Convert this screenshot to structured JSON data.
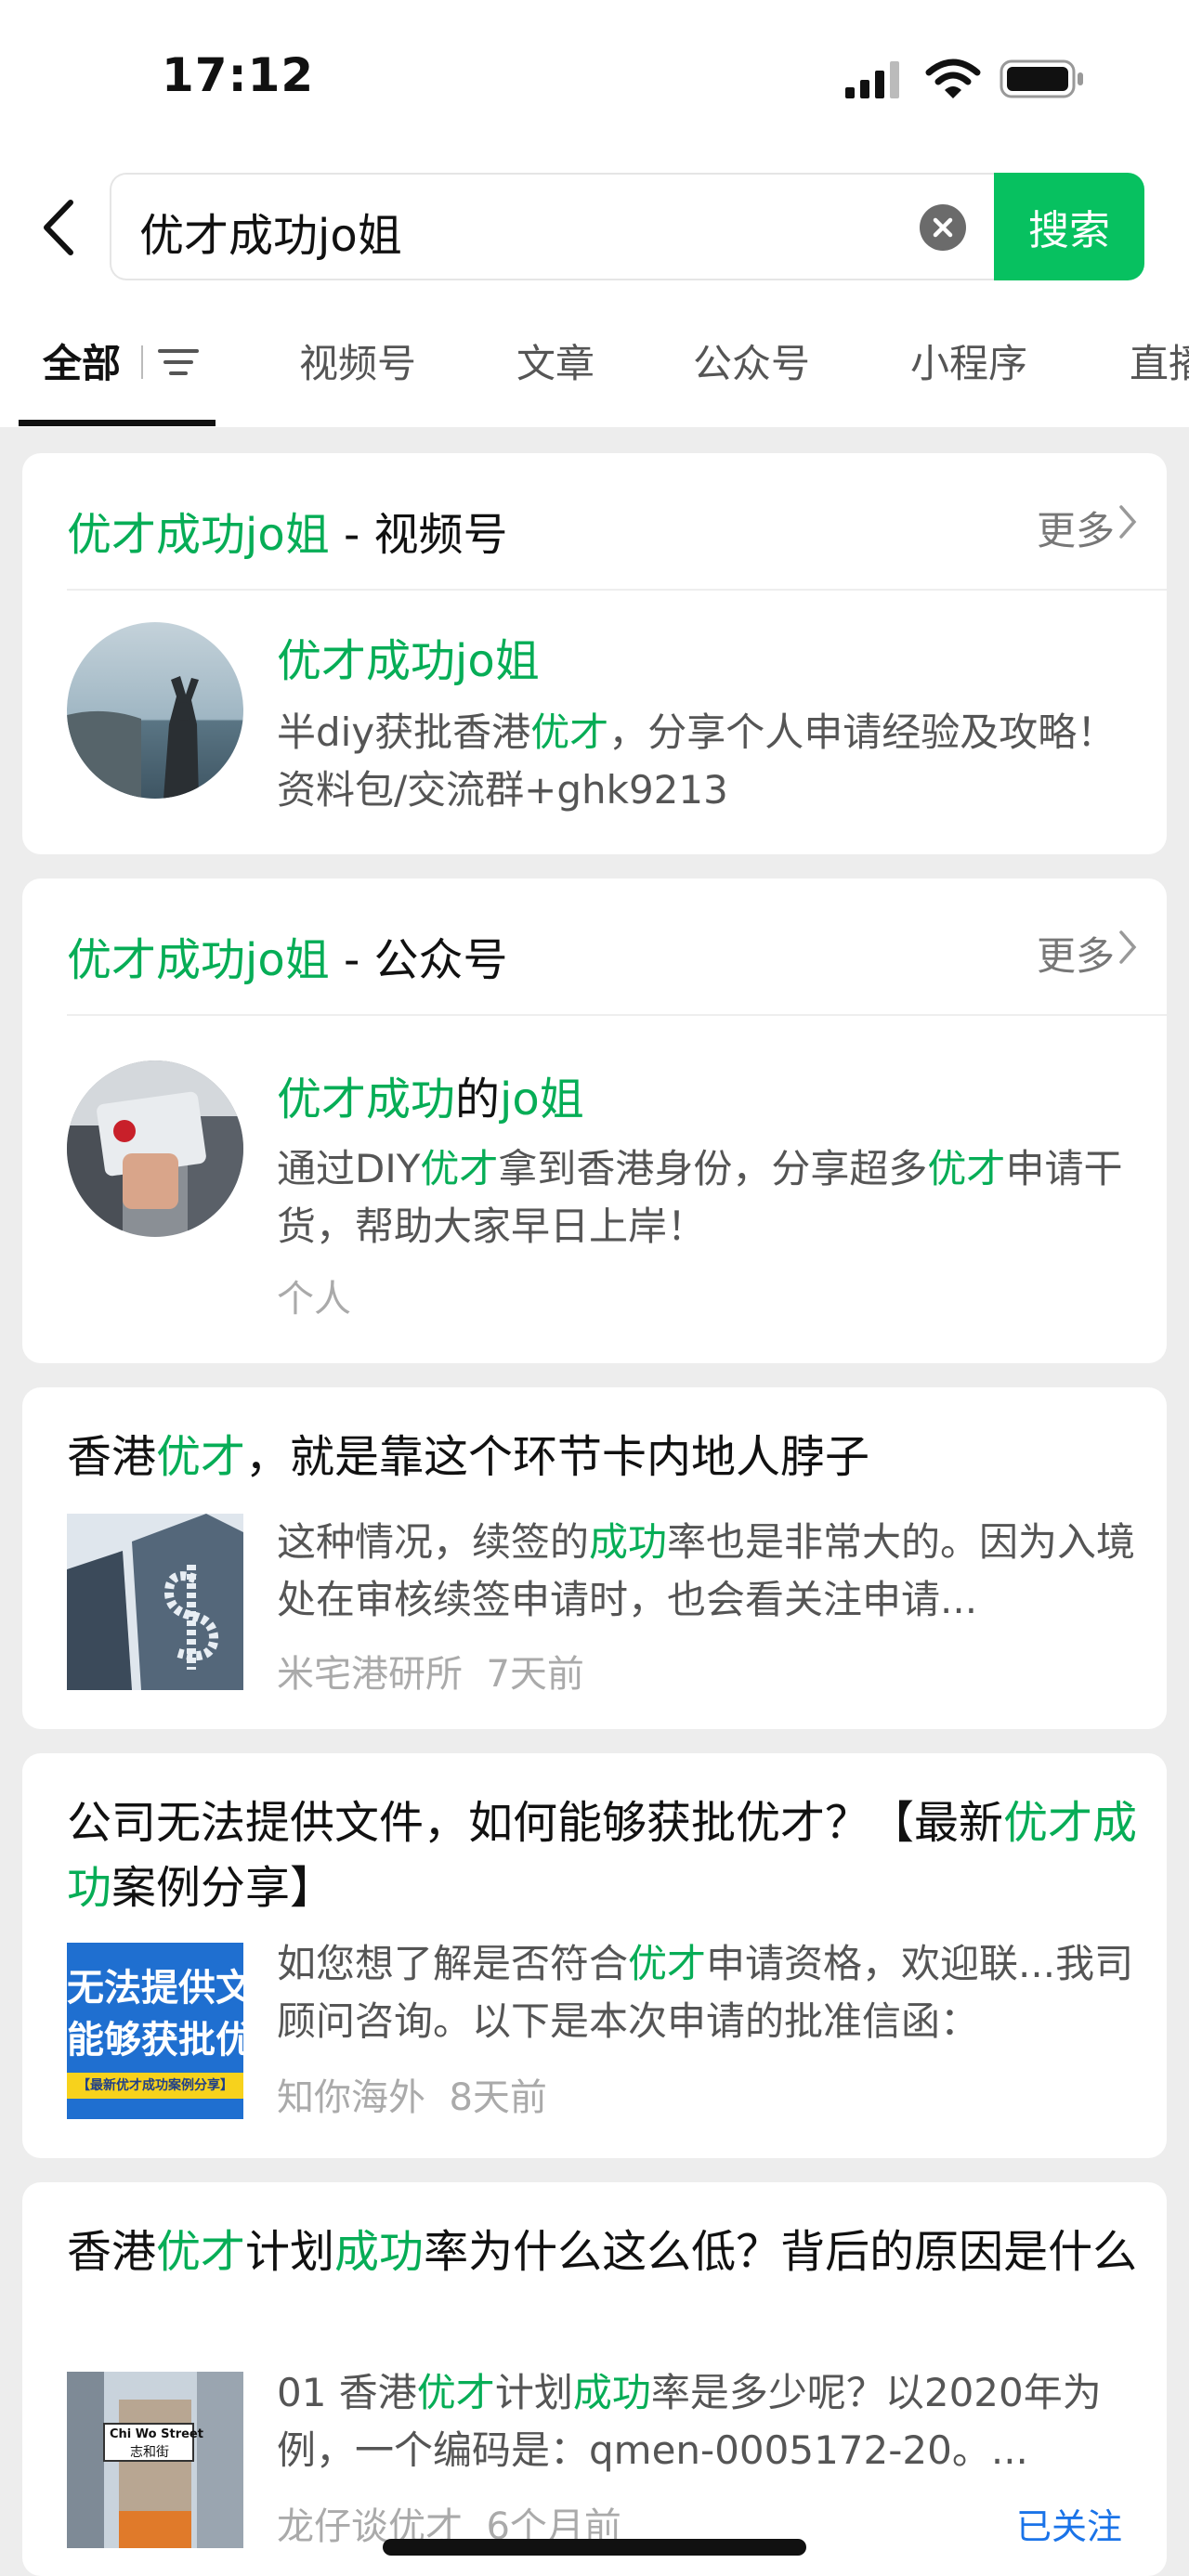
{
  "status_bar": {
    "time": "17:12"
  },
  "search": {
    "query": "优才成功jo姐",
    "button_label": "搜索"
  },
  "tabs": [
    {
      "label": "全部"
    },
    {
      "label": "视频号"
    },
    {
      "label": "文章"
    },
    {
      "label": "公众号"
    },
    {
      "label": "小程序"
    },
    {
      "label": "直播"
    }
  ],
  "video_section": {
    "title_highlight": "优才成功jo姐",
    "title_suffix": " - 视频号",
    "more_label": "更多",
    "account_name": "优才成功jo姐",
    "desc_a": "半diy获批香港",
    "desc_hl": "优才",
    "desc_b": "，分享个人申请经验及攻略！ 资料包/交流群+ghk9213"
  },
  "oa_section": {
    "title_highlight": "优才成功jo姐",
    "title_suffix": " - 公众号",
    "more_label": "更多",
    "name_hl1": "优才成功",
    "name_mid": "的",
    "name_hl2": "jo姐",
    "desc_a": "通过DIY",
    "desc_hl1": "优才",
    "desc_b": "拿到香港身份，分享超多",
    "desc_hl2": "优才",
    "desc_c": "申请干货，帮助大家早日上岸！",
    "type_label": "个人"
  },
  "articles": [
    {
      "title_a": "香港",
      "title_hl": "优才",
      "title_b": "，就是靠这个环节卡内地人脖子",
      "snippet_a": "这种情况，续签的",
      "snippet_hl": "成功",
      "snippet_b": "率也是非常大的。因为入境处在审核续签申请时，也会看关注申请...",
      "source": "米宅港研所",
      "time": "7天前"
    },
    {
      "title_a": "公司无法提供文件，如何能够获批优才？【最新",
      "title_hl": "优才成功",
      "title_b": "案例分享】",
      "snippet_a": "如您想了解是否符合",
      "snippet_hl": "优才",
      "snippet_b": "申请资格，欢迎联...我司顾问咨询。以下是本次申请的批准信函：",
      "source": "知你海外",
      "time": "8天前",
      "thumb_line1": "无法提供文",
      "thumb_line2": "能够获批优",
      "thumb_banner": "【最新优才成功案例分享】"
    },
    {
      "title_a": "香港",
      "title_hl": "优才",
      "title_b": "计划",
      "title_hl2": "成功",
      "title_c": "率为什么这么低？背后的原因是什么",
      "snippet_a": "01 香港",
      "snippet_hl": "优才",
      "snippet_b": "计划",
      "snippet_hl2": "成功",
      "snippet_c": "率是多少呢？以2020年为例，一个编码是：qmen-0005172-20。...",
      "source": "龙仔谈优才",
      "time": "6个月前",
      "followed_label": "已关注",
      "thumb_sign": "Chi Wo Street",
      "thumb_sign_cn": "志和街"
    }
  ],
  "colors": {
    "accent": "#07c160",
    "highlight": "#06ad56",
    "link": "#1a73e8"
  }
}
